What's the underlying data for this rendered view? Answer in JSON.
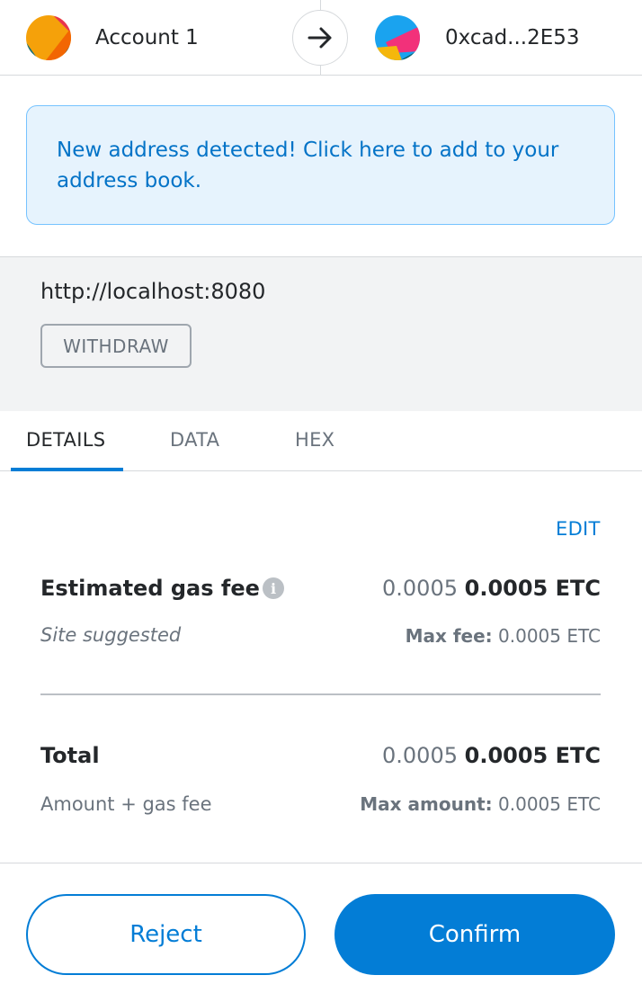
{
  "header": {
    "from_account": {
      "name": "Account 1",
      "avatar_icon": "jazzicon-avatar"
    },
    "arrow_icon": "arrow-right-icon",
    "to_account": {
      "name": "0xcad...2E53",
      "avatar_icon": "jazzicon-avatar"
    }
  },
  "banner": {
    "text": "New address detected! Click here to add to your address book."
  },
  "origin": {
    "url": "http://localhost:8080",
    "method": "WITHDRAW"
  },
  "tabs": [
    {
      "label": "DETAILS",
      "active": true
    },
    {
      "label": "DATA",
      "active": false
    },
    {
      "label": "HEX",
      "active": false
    }
  ],
  "details": {
    "edit_label": "EDIT",
    "gas": {
      "label": "Estimated gas fee",
      "info_icon": "info-icon",
      "amount_secondary": "0.0005",
      "amount_primary": "0.0005 ETC",
      "sub_label": "Site suggested",
      "max_label": "Max fee:",
      "max_value": "0.0005 ETC"
    },
    "total": {
      "label": "Total",
      "amount_secondary": "0.0005",
      "amount_primary": "0.0005 ETC",
      "sub_label": "Amount + gas fee",
      "max_label": "Max amount:",
      "max_value": "0.0005 ETC"
    }
  },
  "buttons": {
    "reject": "Reject",
    "confirm": "Confirm"
  },
  "colors": {
    "primary": "#037dd6",
    "banner_bg": "#e6f3fd",
    "banner_border": "#76c3ff"
  }
}
